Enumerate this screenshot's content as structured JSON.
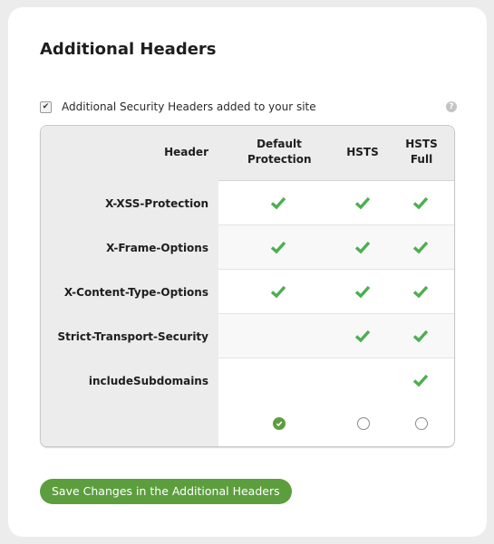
{
  "page": {
    "title": "Additional Headers",
    "option": {
      "label": "Additional Security Headers added to your site",
      "checked": true,
      "check_glyph": "✔",
      "help_glyph": "?"
    },
    "table": {
      "columns": [
        "Header",
        "Default Protection",
        "HSTS",
        "HSTS Full"
      ],
      "column_lines": [
        [
          "Header"
        ],
        [
          "Default",
          "Protection"
        ],
        [
          "HSTS"
        ],
        [
          "HSTS",
          "Full"
        ]
      ],
      "rows": [
        {
          "name": "X-XSS-Protection",
          "default": true,
          "hsts": true,
          "hsts_full": true
        },
        {
          "name": "X-Frame-Options",
          "default": true,
          "hsts": true,
          "hsts_full": true
        },
        {
          "name": "X-Content-Type-Options",
          "default": true,
          "hsts": true,
          "hsts_full": true
        },
        {
          "name": "Strict-Transport-Security",
          "default": false,
          "hsts": true,
          "hsts_full": true
        },
        {
          "name": "includeSubdomains",
          "default": false,
          "hsts": false,
          "hsts_full": true
        }
      ],
      "selection": {
        "selected": "Default Protection",
        "options": [
          "Default Protection",
          "HSTS",
          "HSTS Full"
        ]
      }
    },
    "save_button": "Save Changes in the Additional Headers",
    "colors": {
      "accent": "#5c9e3e",
      "check": "#4caf50"
    }
  }
}
